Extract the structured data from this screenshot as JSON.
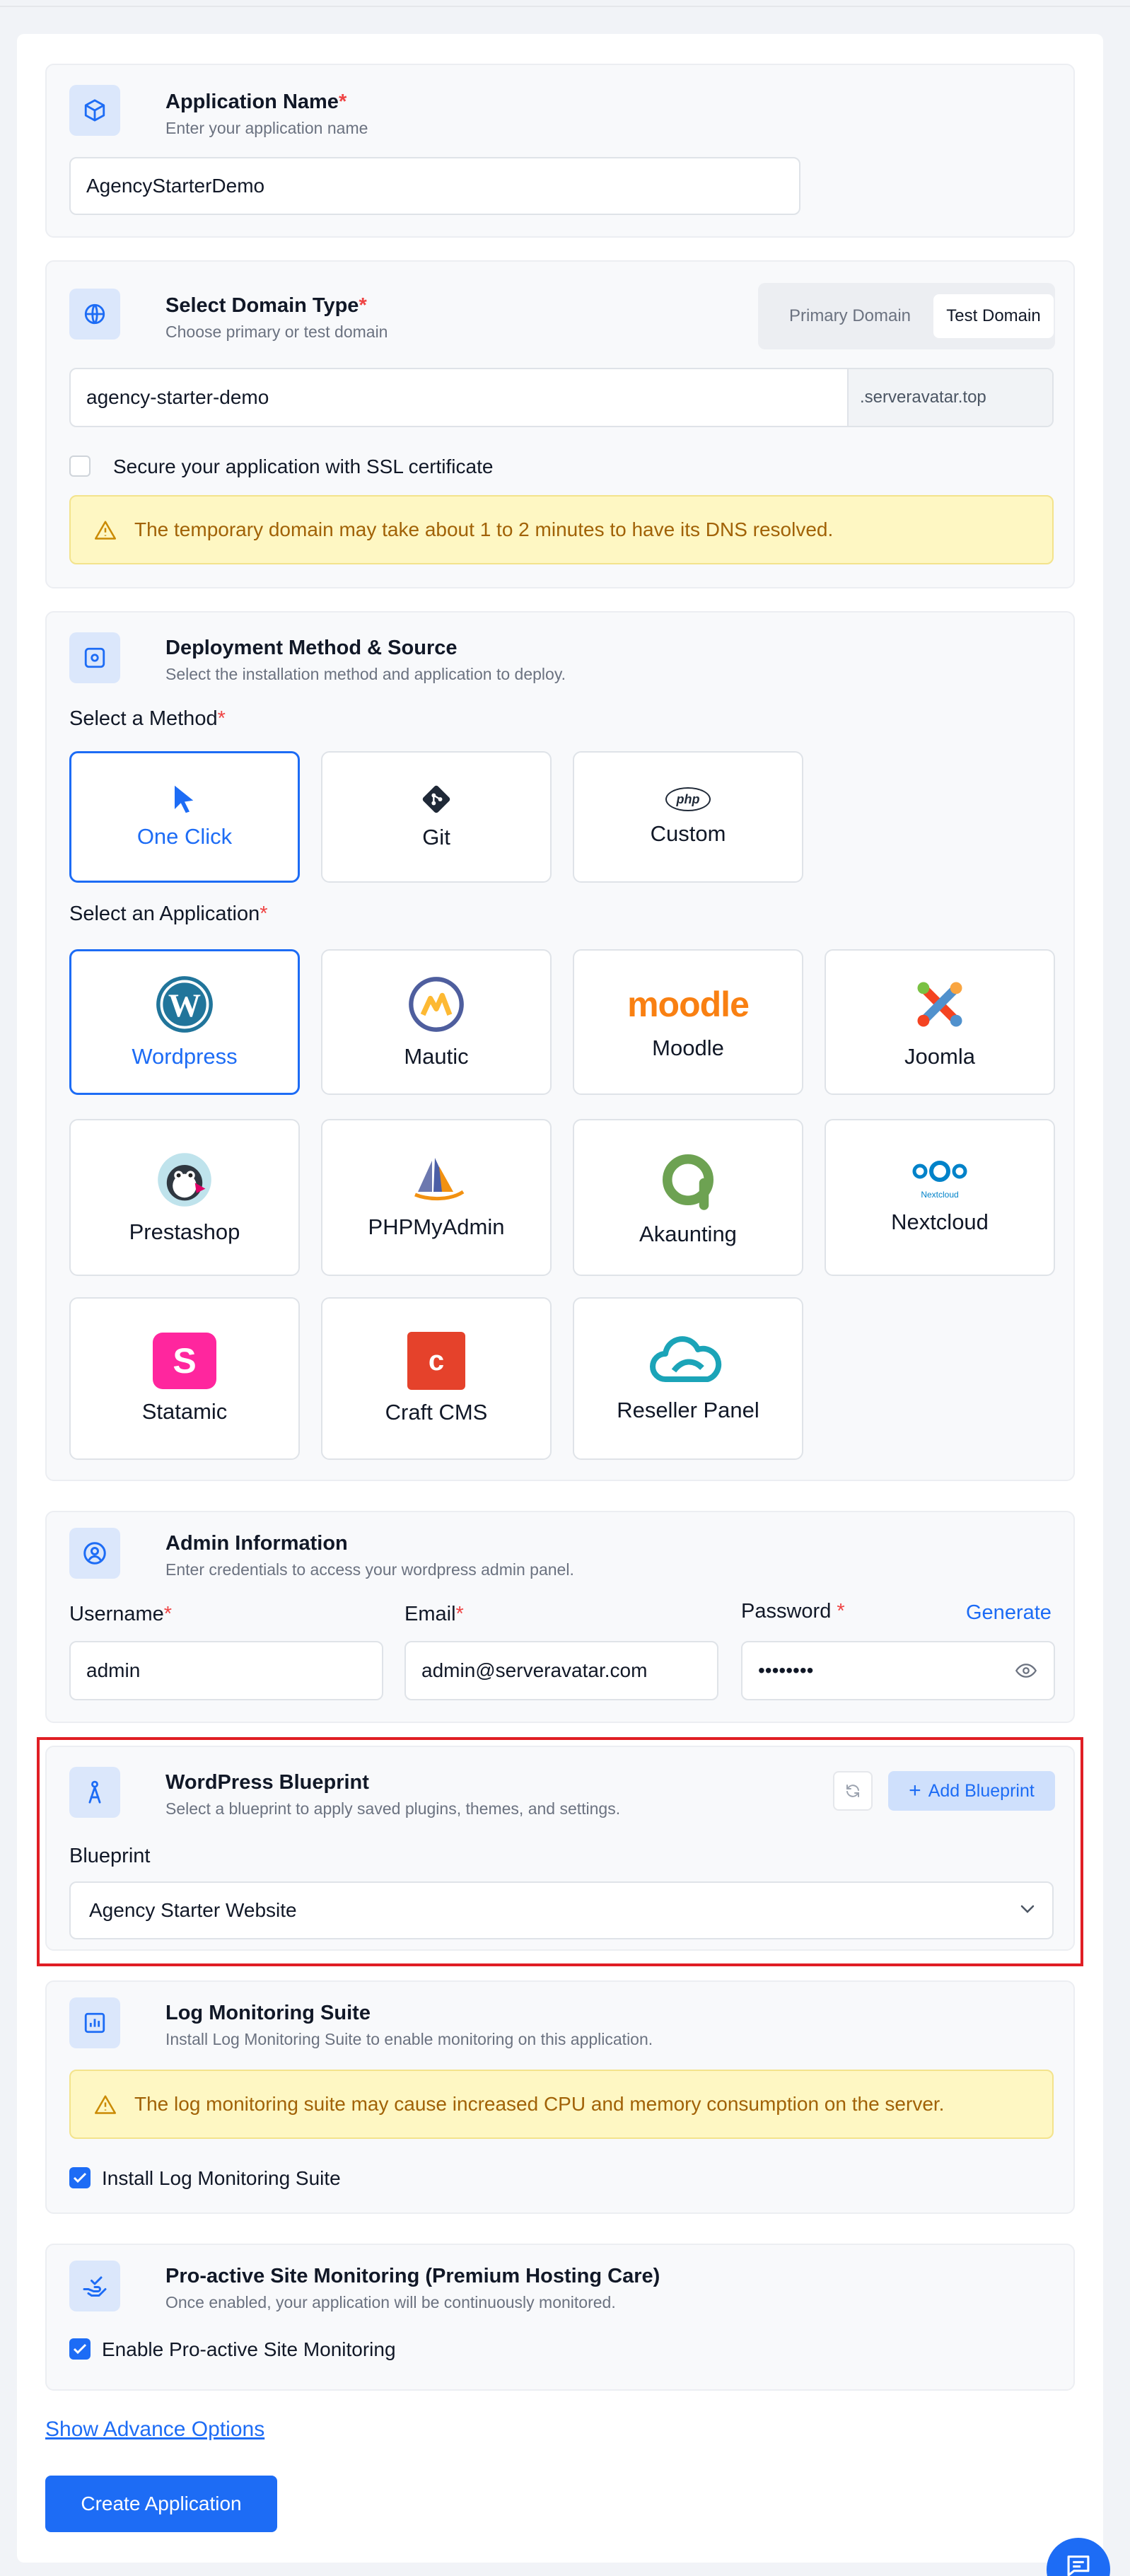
{
  "app_name": {
    "title": "Application Name",
    "subtitle": "Enter your application name",
    "value": "AgencyStarterDemo"
  },
  "domain": {
    "title": "Select Domain Type",
    "subtitle": "Choose primary or test domain",
    "tabs": [
      "Primary Domain",
      "Test Domain"
    ],
    "value": "agency-starter-demo",
    "suffix": ".serveravatar.top",
    "ssl_label": "Secure your application with SSL certificate",
    "warning": "The temporary domain may take about 1 to 2 minutes to have its DNS resolved."
  },
  "deploy": {
    "title": "Deployment Method & Source",
    "subtitle": "Select the installation method and application to deploy.",
    "method_label": "Select a Method",
    "methods": [
      "One Click",
      "Git",
      "Custom"
    ],
    "app_label": "Select an Application",
    "apps": [
      "Wordpress",
      "Mautic",
      "Moodle",
      "Joomla",
      "Prestashop",
      "PHPMyAdmin",
      "Akaunting",
      "Nextcloud",
      "Statamic",
      "Craft CMS",
      "Reseller Panel"
    ],
    "moodle_logo": "moodle",
    "nextcloud_logo": "Nextcloud",
    "php_logo": "php",
    "craft_logo": "c",
    "statamic_logo": "S"
  },
  "admin": {
    "title": "Admin Information",
    "subtitle": "Enter credentials to access your wordpress admin panel.",
    "username_label": "Username",
    "username": "admin",
    "email_label": "Email",
    "email": "admin@serveravatar.com",
    "password_label": "Password",
    "password": "••••••••",
    "generate": "Generate"
  },
  "blueprint": {
    "title": "WordPress Blueprint",
    "subtitle": "Select a blueprint to apply saved plugins, themes, and settings.",
    "add": "Add Blueprint",
    "label": "Blueprint",
    "selected": "Agency Starter Website"
  },
  "log": {
    "title": "Log Monitoring Suite",
    "subtitle": "Install Log Monitoring Suite to enable monitoring on this application.",
    "warning": "The log monitoring suite may cause increased CPU and memory consumption on the server.",
    "checkbox": "Install Log Monitoring Suite"
  },
  "proactive": {
    "title": "Pro-active Site Monitoring (Premium Hosting Care)",
    "subtitle": "Once enabled, your application will be continuously monitored.",
    "checkbox": "Enable Pro-active Site Monitoring"
  },
  "advance_link": "Show Advance Options",
  "create_button": "Create Application",
  "colors": {
    "primary": "#1d6cf5",
    "highlight": "#e01e24",
    "warning_bg": "#fef7c3",
    "warning_text": "#a16207"
  }
}
